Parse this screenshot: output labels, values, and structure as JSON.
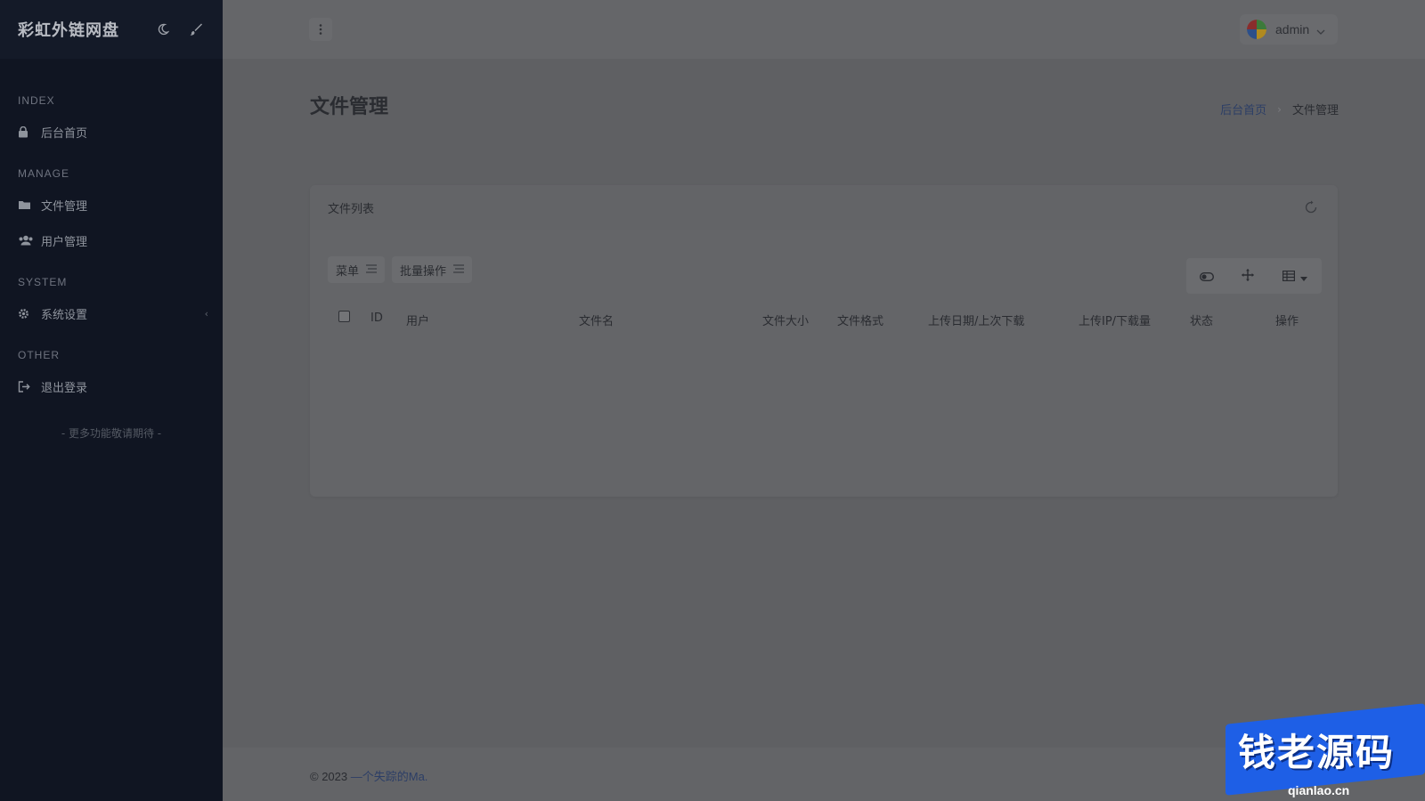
{
  "sidebar": {
    "brand": "彩虹外链网盘",
    "sections": [
      {
        "title": "INDEX",
        "items": [
          {
            "label": "后台首页",
            "icon": "dashboard-icon"
          }
        ]
      },
      {
        "title": "MANAGE",
        "items": [
          {
            "label": "文件管理",
            "icon": "folder-icon"
          },
          {
            "label": "用户管理",
            "icon": "users-icon"
          }
        ]
      },
      {
        "title": "SYSTEM",
        "items": [
          {
            "label": "系统设置",
            "icon": "gear-icon",
            "caret": "‹"
          }
        ]
      },
      {
        "title": "OTHER",
        "items": [
          {
            "label": "退出登录",
            "icon": "logout-icon"
          }
        ]
      }
    ],
    "more_note": "- 更多功能敬请期待 -"
  },
  "topbar": {
    "user_name": "admin"
  },
  "page": {
    "title": "文件管理",
    "breadcrumb": {
      "home": "后台首页",
      "separator": "›",
      "current": "文件管理"
    }
  },
  "card": {
    "title": "文件列表",
    "toolbar": {
      "menu_label": "菜单",
      "batch_label": "批量操作"
    },
    "columns": [
      "ID",
      "用户",
      "文件名",
      "文件大小",
      "文件格式",
      "上传日期/上次下载",
      "上传IP/下载量",
      "状态",
      "操作"
    ]
  },
  "footer": {
    "prefix": "© 2023 ",
    "link": "—个失踪的Ma."
  },
  "watermark": {
    "text": "钱老源码",
    "url": "qianlao.cn"
  },
  "colors": {
    "sidebar_bg": "#101522",
    "overlay_bg": "#5f6063",
    "link": "#2c3e66",
    "watermark_blue": "#1e5fe6"
  }
}
